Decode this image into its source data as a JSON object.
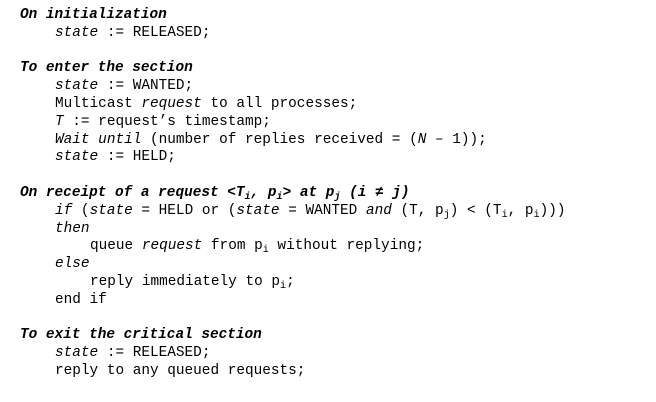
{
  "sections": [
    {
      "heading": "On initialization",
      "lines": [
        "state := RELEASED;"
      ]
    },
    {
      "heading": "To enter the section",
      "lines": [
        "state := WANTED;",
        "Multicast request to all processes;",
        "T := request’s timestamp;",
        "Wait until (number of replies received = (N – 1));",
        "state := HELD;"
      ]
    },
    {
      "heading_parts": [
        "On receipt of a request <T",
        "i",
        ", p",
        "i",
        "> at p",
        "j",
        " (i ≠ j)"
      ],
      "heading": "On receipt of a request <Ti, pi> at pj (i ≠ j)",
      "lines": [
        "if (state = HELD or (state = WANTED and (T, pj) < (Ti, pi)))",
        "then",
        "queue request from pi without replying;",
        "else",
        "reply immediately to pi;",
        "end if"
      ]
    },
    {
      "heading": "To exit the critical section",
      "lines": [
        "state := RELEASED;",
        "reply to any queued requests;"
      ]
    }
  ],
  "tokens": {
    "state": "state",
    "assign": " := ",
    "released": "RELEASED;",
    "wanted": "WANTED;",
    "held": "HELD;",
    "multicast": "Multicast ",
    "request": "request",
    "to_all": " to all processes;",
    "T": "T",
    "ts": " := request’s timestamp;",
    "wait_until": "Wait until",
    "replies": " (number of replies received = (",
    "N": "N",
    "minus_one": " – 1));",
    "if": "if",
    "open_paren": " (",
    "eq_held_or": " = HELD or (",
    "eq_wanted": " = WANTED ",
    "and": "and",
    "T_paren": " (T, p",
    "j": "j",
    "lt": ") < (T",
    "i": "i",
    "comma_p": ", p",
    "close": ")))",
    "then": "then",
    "queue": "queue ",
    "from_p": " from p",
    "without": " without replying;",
    "else": "else",
    "reply_imm": "reply immediately to p",
    "semicolon": ";",
    "end_if": "end if",
    "reply_queued": "reply to any queued requests;"
  }
}
